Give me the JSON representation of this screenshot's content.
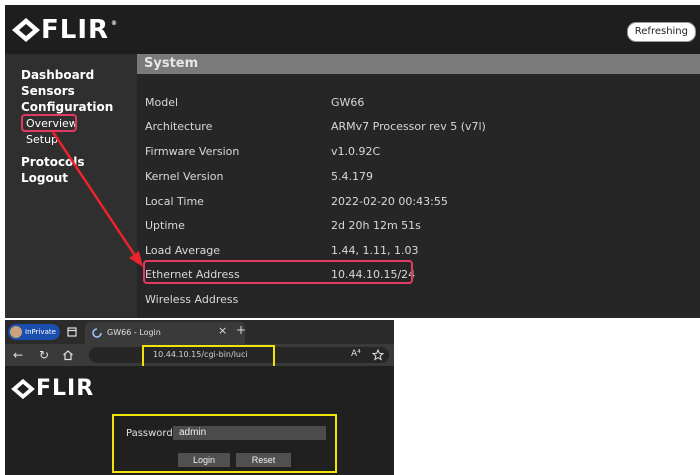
{
  "brand": {
    "logo_text": "FLIR",
    "trademark": "®"
  },
  "top": {
    "refresh_label": "Refreshing",
    "sidebar": {
      "dashboard": "Dashboard",
      "sensors": "Sensors",
      "configuration": "Configuration",
      "overview": "Overview",
      "setup": "Setup",
      "protocols": "Protocols",
      "logout": "Logout"
    },
    "section_title": "System",
    "rows": [
      {
        "label": "Model",
        "value": "GW66"
      },
      {
        "label": "Architecture",
        "value": "ARMv7 Processor rev 5 (v7l)"
      },
      {
        "label": "Firmware Version",
        "value": "v1.0.92C"
      },
      {
        "label": "Kernel Version",
        "value": "5.4.179"
      },
      {
        "label": "Local Time",
        "value": "2022-02-20 00:43:55"
      },
      {
        "label": "Uptime",
        "value": "2d 20h 12m 51s"
      },
      {
        "label": "Load Average",
        "value": "1.44, 1.11, 1.03"
      },
      {
        "label": "Ethernet Address",
        "value": "10.44.10.15/24"
      },
      {
        "label": "Wireless Address",
        "value": ""
      }
    ],
    "highlight_color": "#e23a63"
  },
  "browser": {
    "inprivate_label": "InPrivate",
    "tab_title": "GW66 - Login",
    "close_glyph": "×",
    "new_tab_glyph": "+",
    "url": "10.44.10.15/cgi-bin/luci",
    "read_aloud_glyph": "A⁴",
    "login_form": {
      "password_label": "Password",
      "password_value": "admin",
      "login_button": "Login",
      "reset_button": "Reset"
    },
    "highlight_color": "#f2e205"
  }
}
